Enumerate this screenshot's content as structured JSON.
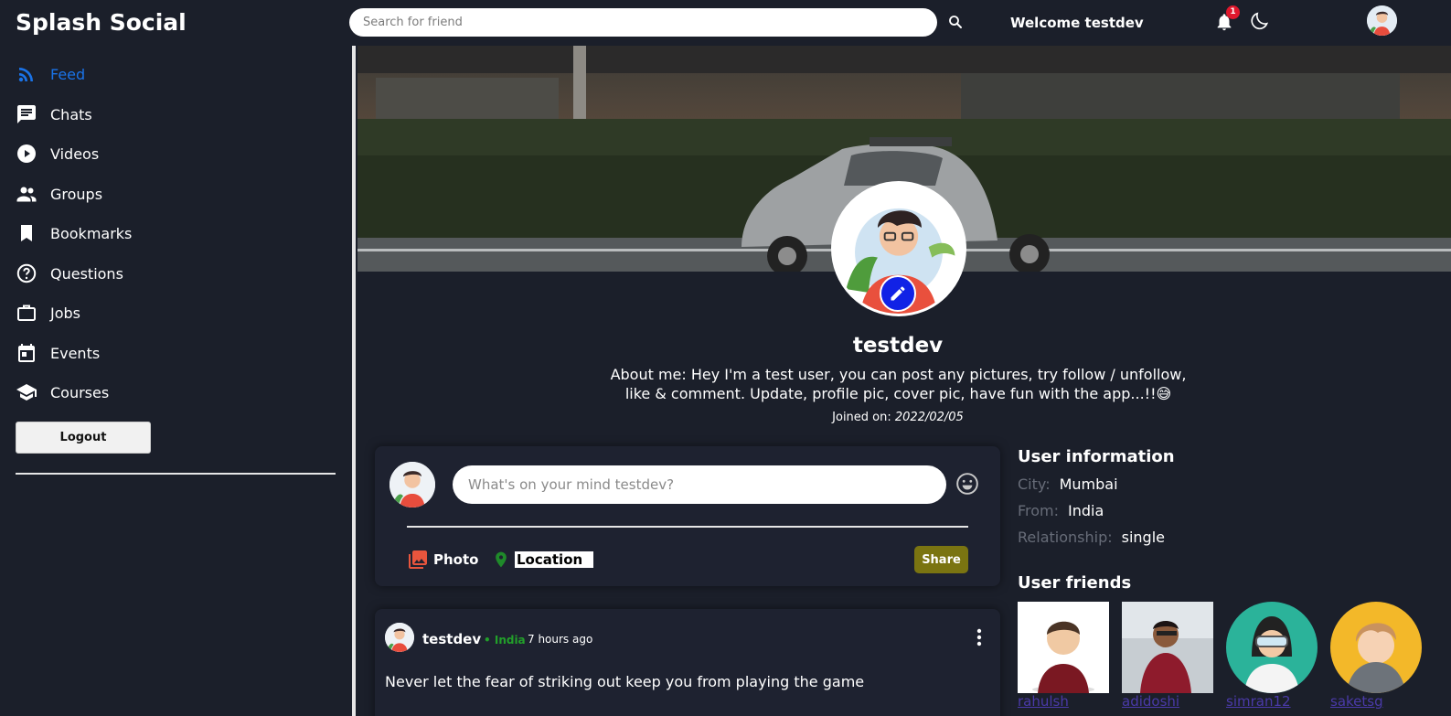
{
  "header": {
    "brand": "Splash Social",
    "search_placeholder": "Search for friend",
    "welcome": "Welcome testdev",
    "notification_count": "1"
  },
  "sidebar": {
    "items": [
      {
        "label": "Feed",
        "icon": "rss-icon",
        "active": true
      },
      {
        "label": "Chats",
        "icon": "chat-icon"
      },
      {
        "label": "Videos",
        "icon": "play-circle-icon"
      },
      {
        "label": "Groups",
        "icon": "group-icon"
      },
      {
        "label": "Bookmarks",
        "icon": "bookmark-icon"
      },
      {
        "label": "Questions",
        "icon": "help-circle-icon"
      },
      {
        "label": "Jobs",
        "icon": "briefcase-icon"
      },
      {
        "label": "Events",
        "icon": "calendar-icon"
      },
      {
        "label": "Courses",
        "icon": "school-icon"
      }
    ],
    "logout_label": "Logout"
  },
  "profile": {
    "username": "testdev",
    "about": "About me: Hey I'm a test user, you can post any pictures, try follow / unfollow, like & comment. Update, profile pic, cover pic, have fun with the app...!!😅",
    "joined_label": "Joined on:",
    "joined_date": "2022/02/05"
  },
  "share": {
    "placeholder": "What's on your mind testdev?",
    "photo_label": "Photo",
    "location_label": "Location",
    "share_label": "Share"
  },
  "post": {
    "user": "testdev",
    "location": "• India",
    "time": "7 hours ago",
    "text": "Never let the fear of striking out keep you from playing the game"
  },
  "user_info": {
    "title": "User information",
    "rows": [
      {
        "key": "City:",
        "value": "Mumbai"
      },
      {
        "key": "From:",
        "value": "India"
      },
      {
        "key": "Relationship:",
        "value": "single"
      }
    ]
  },
  "friends": {
    "title": "User friends",
    "list": [
      "rahulsh",
      "adidoshi",
      "simran12",
      "saketsg"
    ]
  },
  "colors": {
    "background": "#1b1f2a",
    "accent_blue": "#1a73e8",
    "share_button": "#7a7411",
    "location_green": "#22a02a",
    "edit_button": "#1122e6"
  }
}
